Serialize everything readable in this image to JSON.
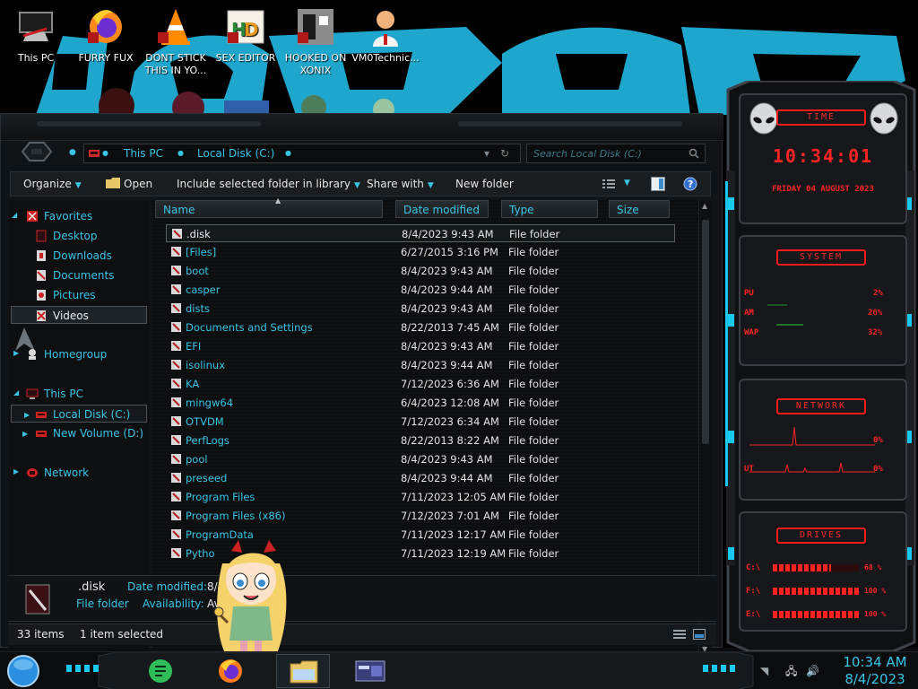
{
  "desktop": {
    "icons": [
      {
        "label": "This PC"
      },
      {
        "label": "FURRY FUX"
      },
      {
        "label": "DONT STICK THIS IN YO..."
      },
      {
        "label": "SEX EDITOR"
      },
      {
        "label": "HOOKED ON XONIX"
      },
      {
        "label": "VM0Technic..."
      }
    ]
  },
  "explorer": {
    "address": {
      "root": "This PC",
      "current": "Local Disk (C:)"
    },
    "search_placeholder": "Search Local Disk (C:)",
    "toolbar": {
      "organize": "Organize",
      "open": "Open",
      "include": "Include selected folder in library",
      "share": "Share with",
      "new_folder": "New folder"
    },
    "nav": {
      "favorites": "Favorites",
      "desktop": "Desktop",
      "downloads": "Downloads",
      "documents": "Documents",
      "pictures": "Pictures",
      "videos": "Videos",
      "homegroup": "Homegroup",
      "this_pc": "This PC",
      "local_disk": "Local Disk (C:)",
      "new_volume": "New Volume (D:)",
      "network": "Network"
    },
    "columns": {
      "name": "Name",
      "date": "Date modified",
      "type": "Type",
      "size": "Size"
    },
    "files": [
      {
        "name": ".disk",
        "date": "8/4/2023 9:43 AM",
        "type": "File folder"
      },
      {
        "name": "[Files]",
        "date": "6/27/2015 3:16 PM",
        "type": "File folder"
      },
      {
        "name": "boot",
        "date": "8/4/2023 9:43 AM",
        "type": "File folder"
      },
      {
        "name": "casper",
        "date": "8/4/2023 9:44 AM",
        "type": "File folder"
      },
      {
        "name": "dists",
        "date": "8/4/2023 9:43 AM",
        "type": "File folder"
      },
      {
        "name": "Documents and Settings",
        "date": "8/22/2013 7:45 AM",
        "type": "File folder"
      },
      {
        "name": "EFI",
        "date": "8/4/2023 9:43 AM",
        "type": "File folder"
      },
      {
        "name": "isolinux",
        "date": "8/4/2023 9:44 AM",
        "type": "File folder"
      },
      {
        "name": "KA",
        "date": "7/12/2023 6:36 AM",
        "type": "File folder"
      },
      {
        "name": "mingw64",
        "date": "6/4/2023 12:08 AM",
        "type": "File folder"
      },
      {
        "name": "OTVDM",
        "date": "7/12/2023 6:34 AM",
        "type": "File folder"
      },
      {
        "name": "PerfLogs",
        "date": "8/22/2013 8:22 AM",
        "type": "File folder"
      },
      {
        "name": "pool",
        "date": "8/4/2023 9:43 AM",
        "type": "File folder"
      },
      {
        "name": "preseed",
        "date": "8/4/2023 9:44 AM",
        "type": "File folder"
      },
      {
        "name": "Program Files",
        "date": "7/11/2023 12:05 AM",
        "type": "File folder"
      },
      {
        "name": "Program Files (x86)",
        "date": "7/12/2023 7:01 AM",
        "type": "File folder"
      },
      {
        "name": "ProgramData",
        "date": "7/11/2023 12:17 AM",
        "type": "File folder"
      },
      {
        "name": "Pytho",
        "date": "7/11/2023 12:19 AM",
        "type": "File folder"
      }
    ],
    "details": {
      "name": ".disk",
      "type": "File folder",
      "date_label": "Date modified:",
      "date_value": "8/4",
      "avail_label": "Availability:",
      "avail_value": "Ava"
    },
    "status": {
      "count": "33 items",
      "selected": "1 item selected"
    }
  },
  "gadget": {
    "time_title": "TIME",
    "time": "10:34:01",
    "date_line": "FRIDAY 04 AUGUST 2023",
    "system_title": "SYSTEM",
    "system_rows": [
      {
        "label": "PU",
        "value": "2%"
      },
      {
        "label": "AM",
        "value": "26%"
      },
      {
        "label": "WAP",
        "value": "32%"
      }
    ],
    "network_title": "NETWORK",
    "network_rows": [
      {
        "value": "0%"
      },
      {
        "label": "UT",
        "value": "0%"
      }
    ],
    "drives_title": "DRIVES",
    "drives": [
      {
        "label": "C:\\",
        "value": "68 %",
        "fill": 0.68
      },
      {
        "label": "F:\\",
        "value": "100 %",
        "fill": 1.0
      },
      {
        "label": "E:\\",
        "value": "100 %",
        "fill": 1.0
      }
    ]
  },
  "taskbar": {
    "time": "10:34 AM",
    "date": "8/4/2023",
    "colors": {
      "accent": "#39c4e6",
      "gadget_red": "#ff2424"
    }
  }
}
